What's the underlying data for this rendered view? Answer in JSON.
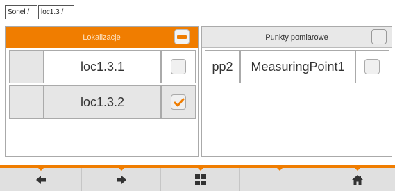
{
  "breadcrumb": [
    "Sonel /",
    "loc1.3 /"
  ],
  "locations_panel": {
    "title": "Lokalizacje",
    "rows": [
      {
        "name": "loc1.3.1",
        "checked": false
      },
      {
        "name": "loc1.3.2",
        "checked": true
      }
    ]
  },
  "measuring_points_panel": {
    "title": "Punkty pomiarowe",
    "rows": [
      {
        "id": "pp2",
        "name": "MeasuringPoint1",
        "checked": false
      }
    ]
  },
  "footer": {
    "buttons": [
      "arrow-left-icon",
      "arrow-right-icon",
      "grid-icon",
      "blank",
      "home-icon"
    ]
  },
  "colors": {
    "accent": "#f07d00",
    "panel_grey": "#e6e6e6",
    "footer_bg": "#e0e0e0"
  }
}
